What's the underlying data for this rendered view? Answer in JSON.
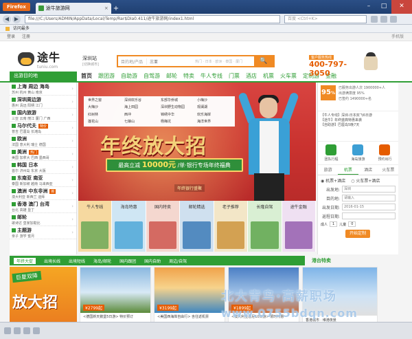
{
  "browser": {
    "menu_button": "Firefox",
    "tab_title": "途牛旅游网",
    "url": "file:///C:/Users/ADMIN/AppData/Local/Temp/Rar$DIa0.411/途牛旅游网/index1.html",
    "search_placeholder": "百度 <Ctrl+K>",
    "bookmark": "访问最多"
  },
  "topbar": {
    "links": [
      "登录",
      "注册"
    ],
    "right": "手机版"
  },
  "header": {
    "logo_cn": "途牛",
    "logo_en": "tuniu.com",
    "city": "深圳站",
    "city_sub": "[切换城市]",
    "search_category": "目的地/产品",
    "search_value": "三亚",
    "search_hot": "热门 · 日本 · 欧洲 · 泰国 · 厦门",
    "search_button": "🔍",
    "hotline_badge": "客户服务热线",
    "hotline": "400-797-3050"
  },
  "menu": {
    "all": "出游目的地",
    "items": [
      "首页",
      "跟团游",
      "自助游",
      "自驾游",
      "邮轮",
      "特卖",
      "牛人专线",
      "门票",
      "酒店",
      "机票",
      "火车票",
      "定制游",
      "金融"
    ]
  },
  "sidebar": [
    {
      "title": "上海 周边 海岛",
      "tag": "",
      "sub": "苏州 杭州 黄山 南京"
    },
    {
      "title": "深圳周边游",
      "tag": "",
      "sub": "惠州 清远 阳朔 江门"
    },
    {
      "title": "国内旅游",
      "tag": "",
      "sub": "三亚 云南 丽江 厦门 广西"
    },
    {
      "title": "马尔代夫",
      "tag": "特价",
      "sub": "普吉 巴厘岛 长滩岛"
    },
    {
      "title": "欧洲",
      "tag": "",
      "sub": "法国 意大利 瑞士 德国"
    },
    {
      "title": "美洲",
      "tag": "热门",
      "sub": "美国 加拿大 巴西 墨西哥"
    },
    {
      "title": "韩国 日本",
      "tag": "",
      "sub": "首尔 济州岛 东京 大阪"
    },
    {
      "title": "东南亚 南亚",
      "tag": "",
      "sub": "泰国 新加坡 越南 马来西亚"
    },
    {
      "title": "澳洲 中东非洲",
      "tag": "新",
      "sub": "澳大利亚 新西兰 迪拜"
    },
    {
      "title": "香港 澳门 台湾",
      "tag": "",
      "sub": "台北 高雄 垦丁"
    },
    {
      "title": "邮轮",
      "tag": "",
      "sub": "歌诗达 皇家加勒比"
    },
    {
      "title": "主题游",
      "tag": "",
      "sub": "亲子 游学 蜜月"
    }
  ],
  "banner": {
    "destinations": [
      "世界之窗",
      "深圳欢乐谷",
      "东部华侨城",
      "小梅沙",
      "大梅沙",
      "海上田园",
      "深圳野生动物园",
      "观澜湖",
      "红树林",
      "西冲",
      "锦绣中华",
      "欢乐海岸",
      "莲花山",
      "七娘山",
      "杨梅坑",
      "海洋世界"
    ],
    "title": "年终放大招",
    "ribbon_prefix": "最高立减",
    "ribbon_amount": "10000元",
    "ribbon_suffix": "/单·银行专场年终福典",
    "caption": "年终银行盛聚"
  },
  "tiles": [
    {
      "label": "牛人专线",
      "color": "#f6d9a0",
      "art": "#5aa24e"
    },
    {
      "label": "海岛特惠",
      "color": "#cfe6f4",
      "art": "#3d9fd4"
    },
    {
      "label": "国内特卖",
      "color": "#f4d7cf",
      "art": "#c9463d"
    },
    {
      "label": "邮轮精选",
      "color": "#cfe0ef",
      "art": "#2a6fb0"
    },
    {
      "label": "老子推荐",
      "color": "#f3e6c7",
      "art": "#c88a2b"
    },
    {
      "label": "长隆自驾",
      "color": "#d9efd3",
      "art": "#4d9c3b"
    },
    {
      "label": "途牛金融",
      "color": "#efe0f2",
      "art": "#8a4ea6"
    }
  ],
  "rightpanel": {
    "score": "95",
    "score_unit": "%",
    "stats": [
      "已服务出游人次 1900000+人",
      "出游满意度 95%",
      "已签约 1490000+名"
    ],
    "news": [
      "【牛人专线】深圳-日本双飞6日游",
      "【途牛】年终盛典特惠来袭",
      "【自助游】巴厘岛5晚7天"
    ],
    "icons": [
      {
        "label": "团队行程",
        "color": "#2f9e35"
      },
      {
        "label": "海岛旅游",
        "color": "#3d9fd4"
      },
      {
        "label": "预约出行",
        "color": "#e55c00"
      }
    ],
    "tabs": [
      "旅游",
      "机票",
      "酒店",
      "火车票"
    ],
    "radio": [
      "机票+酒店",
      "火车票+酒店"
    ],
    "fields": [
      {
        "label": "出发地:",
        "value": "深圳"
      },
      {
        "label": "目的地:",
        "value": "请输入"
      },
      {
        "label": "出发日期:",
        "value": "2016-01-15"
      },
      {
        "label": "返程日期:",
        "value": ""
      }
    ],
    "people_label": "成人",
    "people_value": "1",
    "child_label": "儿童",
    "child_value": "0",
    "submit": "开始定制"
  },
  "bottom_tabs": [
    "年终大促",
    "出境长线",
    "出境短线",
    "海岛/邮轮",
    "国内跟团",
    "国内自助",
    "周边/自驾"
  ],
  "bottom_right_title": "港台特卖",
  "promos": {
    "main_ribbon": "巨星双降",
    "main_big": "放大招",
    "cards": [
      {
        "price": "¥2799起",
        "caption": "<德国新天鹅堡5日游> 特价预订",
        "img": "linear-gradient(180deg,#8ab8e0,#d8e9f5 55%,#5b8a3a)"
      },
      {
        "price": "¥3199起",
        "caption": "<美国西海岸自由行> 含往返机票",
        "img": "linear-gradient(180deg,#f0a24a,#f7d38c 45%,#3f87c0)"
      },
      {
        "price": "¥1899起",
        "caption": "<澳大利亚悉尼10日游> 限时特惠",
        "img": "linear-gradient(180deg,#4b7fc5,#9fc1e6 55%,#c46a3b)"
      }
    ],
    "side_caption": "香港城市 · 维港夜景"
  },
  "watermark": {
    "line1": "北大青鸟·高薪职场",
    "line2": "www.0755bdqn.com"
  }
}
